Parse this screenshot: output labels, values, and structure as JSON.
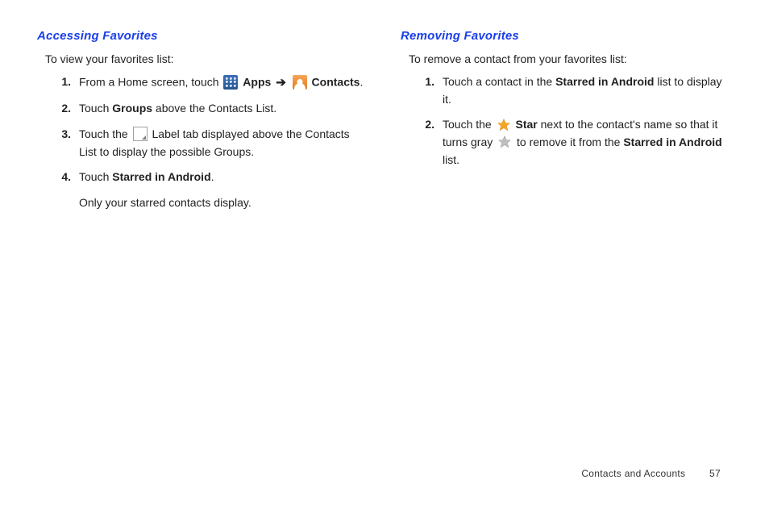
{
  "left": {
    "title": "Accessing Favorites",
    "intro": "To view your favorites list:",
    "steps": [
      {
        "num": "1.",
        "pre": "From a Home screen, touch ",
        "apps_label": "Apps",
        "arrow": "➔",
        "contacts_label": "Contacts",
        "post": "."
      },
      {
        "num": "2.",
        "pre": "Touch ",
        "bold": "Groups",
        "post": " above the Contacts List."
      },
      {
        "num": "3.",
        "pre": "Touch the ",
        "post": " Label tab displayed above the Contacts List to display the possible Groups."
      },
      {
        "num": "4.",
        "pre": "Touch ",
        "bold": "Starred in Android",
        "post": ".",
        "note": "Only your starred contacts display."
      }
    ]
  },
  "right": {
    "title": "Removing Favorites",
    "intro": "To remove a contact from your favorites list:",
    "steps": [
      {
        "num": "1.",
        "pre": "Touch a contact in the ",
        "bold": "Starred in Android",
        "post": " list to display it."
      },
      {
        "num": "2.",
        "pre": "Touch the ",
        "star_label": "Star",
        "mid": " next to the contact's name so that it turns gray ",
        "tail_pre": " to remove it from the ",
        "tail_bold": "Starred in Android",
        "tail_post": " list."
      }
    ]
  },
  "footer": {
    "section": "Contacts and Accounts",
    "page": "57"
  }
}
